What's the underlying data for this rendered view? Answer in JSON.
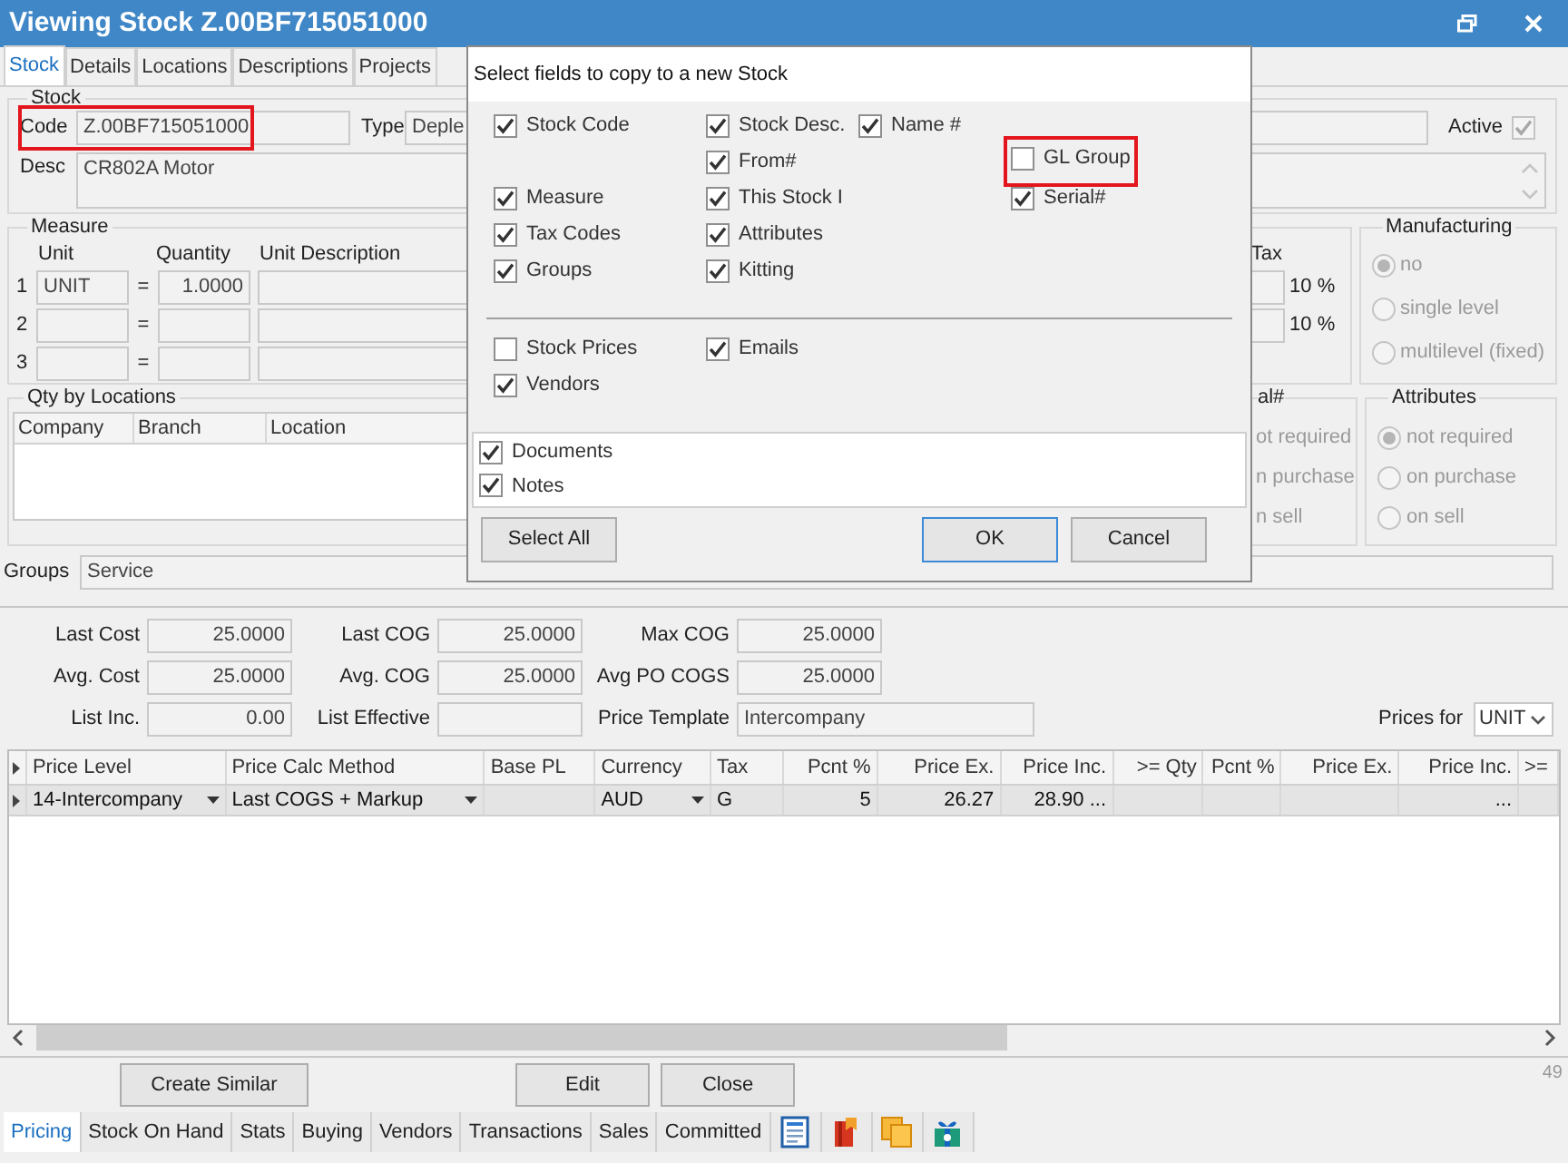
{
  "window": {
    "title": "Viewing Stock Z.00BF715051000"
  },
  "tabs": [
    {
      "label": "Stock",
      "selected": true
    },
    {
      "label": "Details",
      "selected": false
    },
    {
      "label": "Locations",
      "selected": false
    },
    {
      "label": "Descriptions",
      "selected": false
    },
    {
      "label": "Projects",
      "selected": false
    }
  ],
  "stock": {
    "legend": "Stock",
    "code_label": "Code",
    "code": "Z.00BF715051000",
    "code_highlighted": true,
    "type_label": "Type",
    "type": "Deple",
    "active_label": "Active",
    "active": true,
    "desc_label": "Desc",
    "desc": "CR802A Motor"
  },
  "measure": {
    "legend": "Measure",
    "headers": [
      "Unit",
      "Quantity",
      "Unit Description"
    ],
    "tax_header": "Tax",
    "rows": [
      {
        "number": "1",
        "unit": "UNIT",
        "equals": "=",
        "quantity": "1.0000",
        "tax": "10 %"
      },
      {
        "number": "2",
        "equals": "=",
        "tax": "10 %"
      },
      {
        "number": "3",
        "equals": "="
      }
    ]
  },
  "manufacturing": {
    "legend": "Manufacturing",
    "options": [
      {
        "label": "no",
        "selected": true
      },
      {
        "label": "single level",
        "selected": false
      },
      {
        "label": "multilevel (fixed)",
        "selected": false
      }
    ]
  },
  "qty_by_locations": {
    "legend": "Qty by Locations",
    "columns": [
      "Company",
      "Branch",
      "Location"
    ]
  },
  "serial": {
    "legend": "al#",
    "options": [
      "ot required",
      "n purchase",
      "n sell"
    ]
  },
  "attributes": {
    "legend": "Attributes",
    "options": [
      {
        "label": "not required",
        "selected": true
      },
      {
        "label": "on purchase",
        "selected": false
      },
      {
        "label": "on sell",
        "selected": false
      }
    ]
  },
  "groups": {
    "label": "Groups",
    "value": "Service"
  },
  "costs": [
    [
      {
        "label": "Last Cost",
        "value": "25.0000",
        "kind": "number"
      },
      {
        "label": "Last COG",
        "value": "25.0000",
        "kind": "number"
      },
      {
        "label": "Max COG",
        "value": "25.0000",
        "kind": "number"
      }
    ],
    [
      {
        "label": "Avg. Cost",
        "value": "25.0000",
        "kind": "number"
      },
      {
        "label": "Avg. COG",
        "value": "25.0000",
        "kind": "number"
      },
      {
        "label": "Avg PO COGS",
        "value": "25.0000",
        "kind": "number"
      }
    ],
    [
      {
        "label": "List Inc.",
        "value": "0.00",
        "kind": "number"
      },
      {
        "label": "List Effective",
        "kind": "number"
      },
      {
        "label": "Price Template",
        "value": "Intercompany",
        "kind": "text"
      }
    ]
  ],
  "prices_for": {
    "label": "Prices for",
    "value": "UNIT"
  },
  "price_grid": {
    "columns": [
      {
        "label": "Price Level",
        "kind": "text"
      },
      {
        "label": "Price Calc Method",
        "kind": "text"
      },
      {
        "label": "Base PL",
        "kind": "text"
      },
      {
        "label": "Currency",
        "kind": "text"
      },
      {
        "label": "Tax",
        "kind": "text"
      },
      {
        "label": "Pcnt %",
        "kind": "number"
      },
      {
        "label": "Price Ex.",
        "kind": "number"
      },
      {
        "label": "Price Inc.",
        "kind": "number"
      },
      {
        "label": ">= Qty",
        "kind": "number"
      },
      {
        "label": "Pcnt %",
        "kind": "number"
      },
      {
        "label": "Price Ex.",
        "kind": "number"
      },
      {
        "label": "Price Inc.",
        "kind": "number"
      },
      {
        "label": ">=",
        "kind": "text"
      }
    ],
    "rows": [
      {
        "cells": [
          {
            "text": "14-Intercompany",
            "kind": "dropdown"
          },
          {
            "text": "Last COGS + Markup",
            "kind": "dropdown"
          },
          {},
          {
            "text": "AUD",
            "kind": "dropdown"
          },
          {
            "text": "G",
            "kind": "text"
          },
          {
            "text": "5",
            "kind": "number"
          },
          {
            "text": "26.27",
            "kind": "number"
          },
          {
            "text": "28.90 ...",
            "kind": "number"
          },
          {},
          {},
          {},
          {
            "text": "...",
            "kind": "number"
          },
          {}
        ]
      }
    ]
  },
  "buttons": [
    "Create Similar",
    "Edit",
    "Close"
  ],
  "record_count": "49",
  "bottom_tabs": [
    {
      "kind": "text",
      "label": "Pricing",
      "selected": true
    },
    {
      "kind": "text",
      "label": "Stock On Hand",
      "selected": false
    },
    {
      "kind": "text",
      "label": "Stats",
      "selected": false
    },
    {
      "kind": "text",
      "label": "Buying",
      "selected": false
    },
    {
      "kind": "text",
      "label": "Vendors",
      "selected": false
    },
    {
      "kind": "text",
      "label": "Transactions",
      "selected": false
    },
    {
      "kind": "text",
      "label": "Sales",
      "selected": false
    },
    {
      "kind": "text",
      "label": "Committed",
      "selected": false
    },
    {
      "kind": "icon",
      "selected": false
    },
    {
      "kind": "icon",
      "selected": false
    },
    {
      "kind": "icon",
      "selected": false
    },
    {
      "kind": "icon",
      "selected": false
    }
  ],
  "dialog": {
    "title": "Select fields to copy to a new Stock",
    "fields": [
      {
        "label": "Stock Code",
        "checked": true,
        "highlighted": false
      },
      {
        "label": "Stock Desc.",
        "checked": true,
        "highlighted": false
      },
      {
        "label": "Name #",
        "checked": true,
        "highlighted": false
      },
      {
        "label": "From#",
        "checked": true,
        "highlighted": false
      },
      {
        "label": "GL Group",
        "checked": false,
        "highlighted": true
      },
      {
        "label": "Measure",
        "checked": true,
        "highlighted": false
      },
      {
        "label": "This Stock I",
        "checked": true,
        "highlighted": false
      },
      {
        "label": "Serial#",
        "checked": true,
        "highlighted": false
      },
      {
        "label": "Tax Codes",
        "checked": true,
        "highlighted": false
      },
      {
        "label": "Attributes",
        "checked": true,
        "highlighted": false
      },
      {
        "label": "Groups",
        "checked": true,
        "highlighted": false
      },
      {
        "label": "Kitting",
        "checked": true,
        "highlighted": false
      }
    ],
    "extras": [
      {
        "label": "Stock Prices",
        "checked": false
      },
      {
        "label": "Emails",
        "checked": true
      },
      {
        "label": "Vendors",
        "checked": true
      }
    ],
    "attachments": [
      {
        "label": "Documents",
        "checked": true
      },
      {
        "label": "Notes",
        "checked": true
      }
    ],
    "buttons": [
      {
        "label": "Select All",
        "default": false
      },
      {
        "label": "OK",
        "default": true
      },
      {
        "label": "Cancel",
        "default": false
      }
    ]
  }
}
